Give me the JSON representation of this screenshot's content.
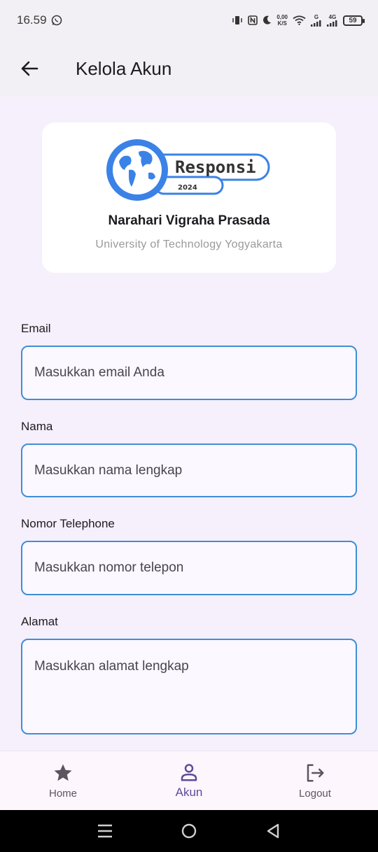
{
  "status_bar": {
    "time": "16.59",
    "net_speed_value": "0,00",
    "net_speed_unit": "K/S",
    "signal1_label": "G",
    "signal2_label": "4G",
    "battery": "59"
  },
  "app_bar": {
    "title": "Kelola Akun"
  },
  "profile": {
    "logo_word": "Responsi",
    "logo_year": "2024",
    "name": "Narahari Vigraha Prasada",
    "university": "University of Technology Yogyakarta"
  },
  "form": {
    "email": {
      "label": "Email",
      "placeholder": "Masukkan email Anda"
    },
    "nama": {
      "label": "Nama",
      "placeholder": "Masukkan nama lengkap"
    },
    "telepon": {
      "label": "Nomor Telephone",
      "placeholder": "Masukkan nomor telepon"
    },
    "alamat": {
      "label": "Alamat",
      "placeholder": "Masukkan alamat lengkap"
    }
  },
  "bottom_nav": {
    "items": [
      {
        "label": "Home",
        "icon": "star-icon"
      },
      {
        "label": "Akun",
        "icon": "person-icon",
        "active": true
      },
      {
        "label": "Logout",
        "icon": "logout-icon"
      }
    ]
  },
  "colors": {
    "accent": "#5d4a99",
    "input_border": "#3d8fd6",
    "logo_blue": "#3b82e6"
  }
}
